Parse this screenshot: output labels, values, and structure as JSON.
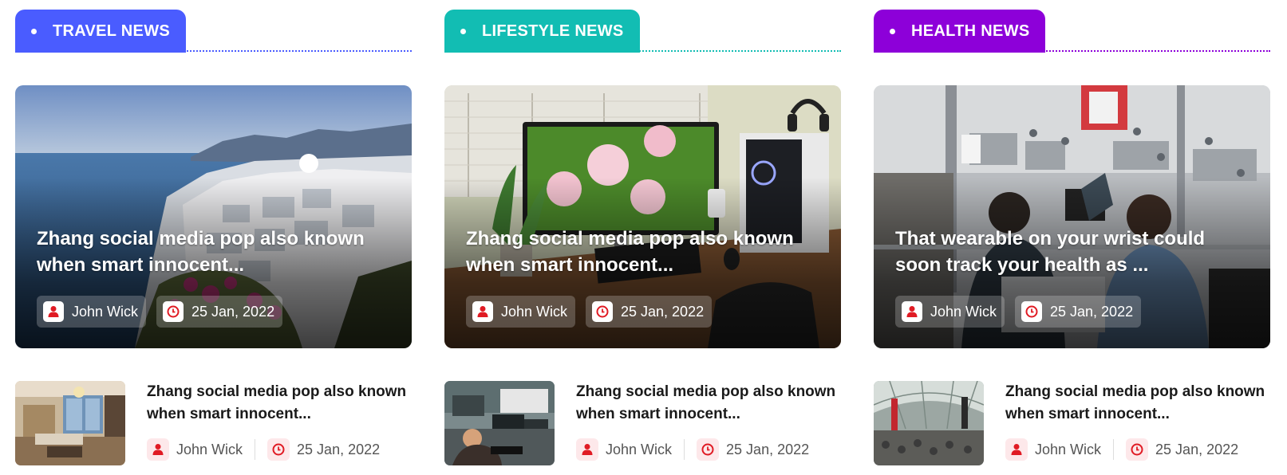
{
  "colors": {
    "travel": "#4a5cff",
    "lifestyle": "#12bdb3",
    "health": "#8d00d9",
    "icon_red": "#e01b24"
  },
  "icons": {
    "author": "user-icon",
    "date": "clock-icon"
  },
  "columns": [
    {
      "tab": "TRAVEL NEWS",
      "hero": {
        "title": "Zhang social media pop also known when smart innocent...",
        "author": "John Wick",
        "date": "25 Jan, 2022"
      },
      "item": {
        "title": "Zhang social media pop also known when smart innocent...",
        "author": "John Wick",
        "date": "25 Jan, 2022"
      }
    },
    {
      "tab": "LIFESTYLE NEWS",
      "hero": {
        "title": "Zhang social media pop also known when smart innocent...",
        "author": "John Wick",
        "date": "25 Jan, 2022"
      },
      "item": {
        "title": "Zhang social media pop also known when smart innocent...",
        "author": "John Wick",
        "date": "25 Jan, 2022"
      }
    },
    {
      "tab": "HEALTH NEWS",
      "hero": {
        "title": "That wearable on your wrist could soon track your health as ...",
        "author": "John Wick",
        "date": "25 Jan, 2022"
      },
      "item": {
        "title": "Zhang social media pop also known when smart innocent...",
        "author": "John Wick",
        "date": "25 Jan, 2022"
      }
    }
  ]
}
